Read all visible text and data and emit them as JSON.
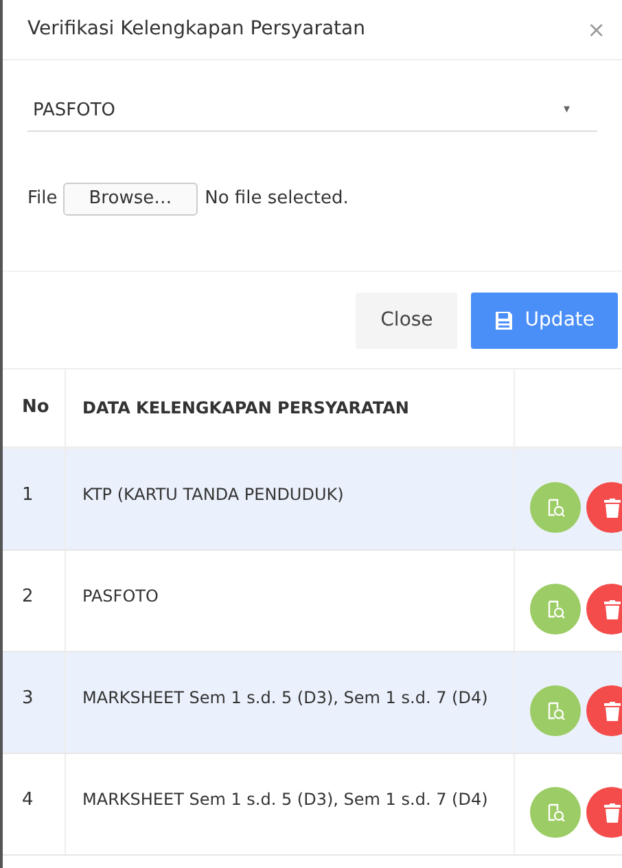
{
  "dialog": {
    "title": "Verifikasi Kelengkapan Persyaratan",
    "close_icon": "×"
  },
  "select": {
    "value": "PASFOTO",
    "caret": "▾"
  },
  "file": {
    "label": "File",
    "button": "Browse…",
    "status": "No file selected."
  },
  "buttons": [
    {
      "kind": "plain",
      "label": "Close"
    },
    {
      "kind": "primary",
      "label": "Update"
    }
  ],
  "table": {
    "columns": [
      "No",
      "DATA KELENGKAPAN PERSYARATAN"
    ],
    "rows": [
      {
        "no": "1",
        "name": "KTP (KARTU TANDA PENDUDUK)"
      },
      {
        "no": "2",
        "name": "PASFOTO"
      },
      {
        "no": "3",
        "name": "MARKSHEET Sem 1 s.d. 5 (D3), Sem 1 s.d. 7 (D4)"
      },
      {
        "no": "4",
        "name": "MARKSHEET Sem 1 s.d. 5 (D3), Sem 1 s.d. 7 (D4)"
      }
    ]
  }
}
